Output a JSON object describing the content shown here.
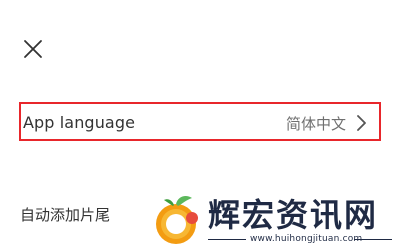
{
  "settings": {
    "language_row": {
      "label": "App language",
      "value": "简体中文"
    },
    "auto_add_row": {
      "label": "自动添加片尾"
    }
  },
  "icons": {
    "close": "close-icon",
    "chevron": "chevron-right-icon"
  },
  "colors": {
    "highlight_border": "#e8262b",
    "text_primary": "#333333",
    "text_secondary": "#6f6f6f"
  },
  "watermark": {
    "title": "辉宏资讯网",
    "url": "www.huihongjituan.com"
  }
}
